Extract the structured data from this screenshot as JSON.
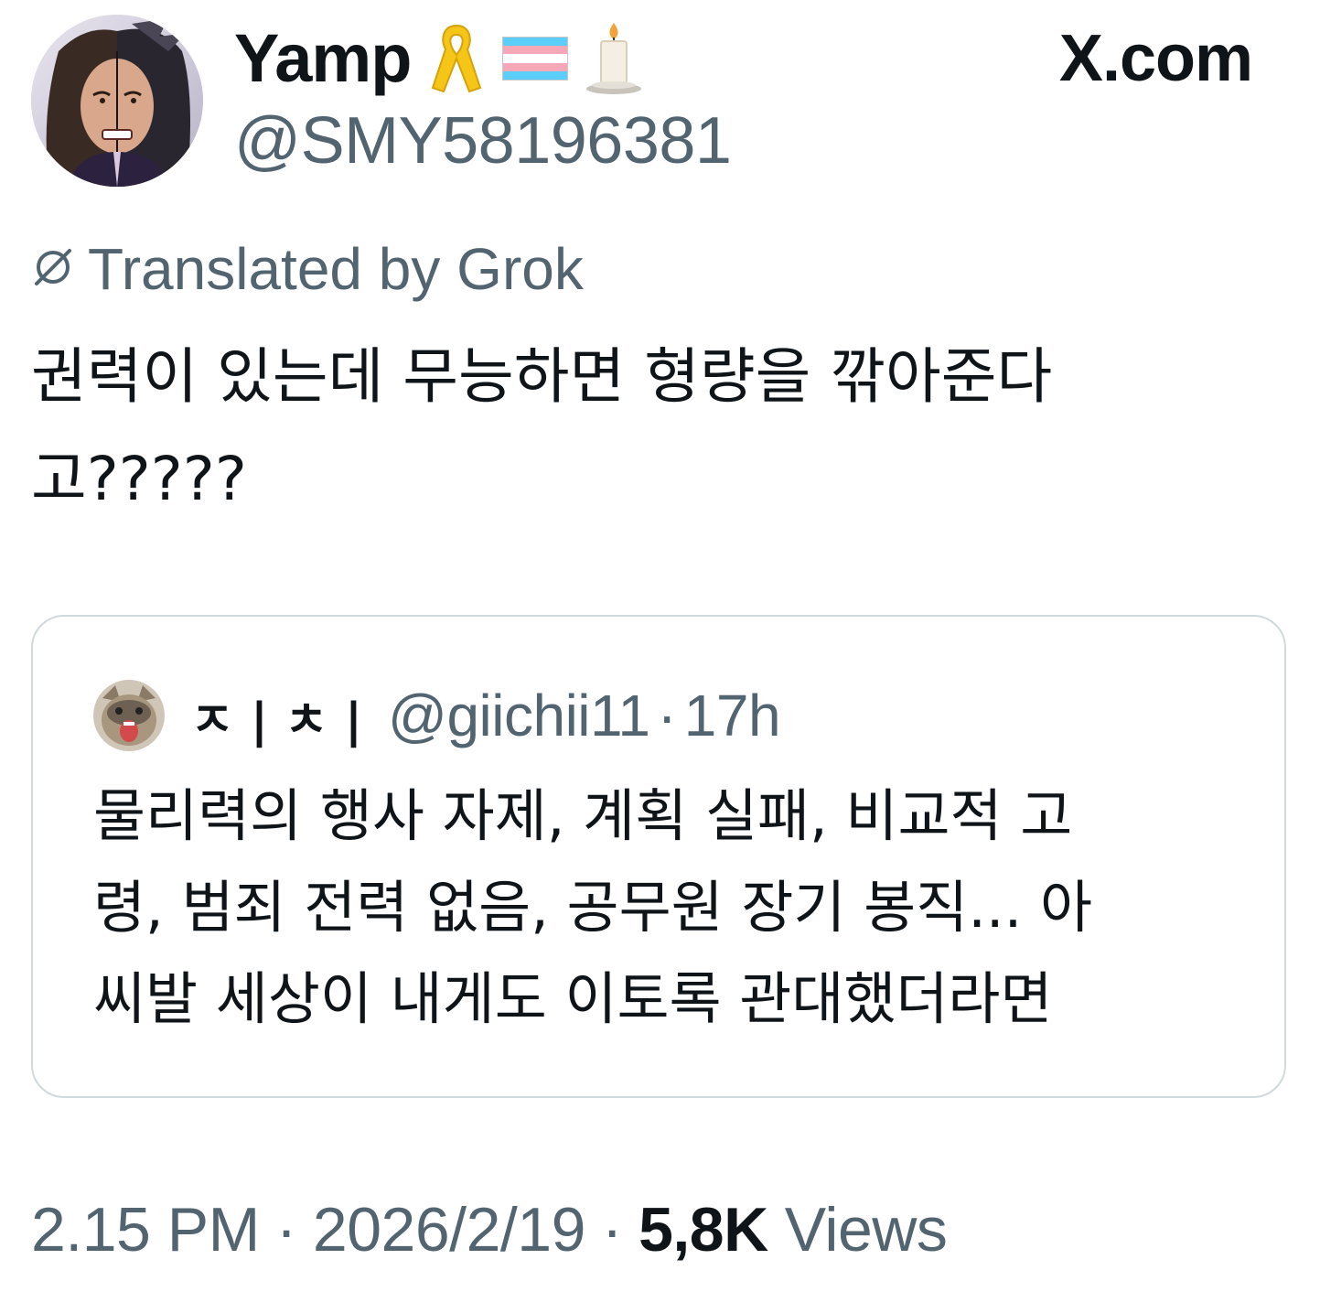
{
  "author": {
    "display_name": "Yamp",
    "handle": "@SMY58196381",
    "badges": [
      "yellow-ribbon-icon",
      "transgender-flag-icon",
      "candle-icon"
    ]
  },
  "site_label": "X.com",
  "translation": {
    "label": "Translated by Grok"
  },
  "tweet": {
    "text": "권력이 있는데 무능하면 형량을 깎아준다\n고?????"
  },
  "quote": {
    "name": "ㅈ | ㅊ |",
    "handle": "@giichii11",
    "time": "17h",
    "separator": "·",
    "text": "물리력의 행사 자제, 계획 실패, 비교적 고\n령, 범죄 전력 없음, 공무원 장기 봉직... 아\n씨발 세상이 내게도 이토록 관대했더라면"
  },
  "meta": {
    "time": "2.15 PM",
    "date": "2026/2/19",
    "views_count": "5,8K",
    "views_label": "Views",
    "separator": "·"
  },
  "colors": {
    "text_primary": "#0f1419",
    "text_secondary": "#536471",
    "border": "#cfd9de",
    "ribbon": "#f5c518"
  }
}
